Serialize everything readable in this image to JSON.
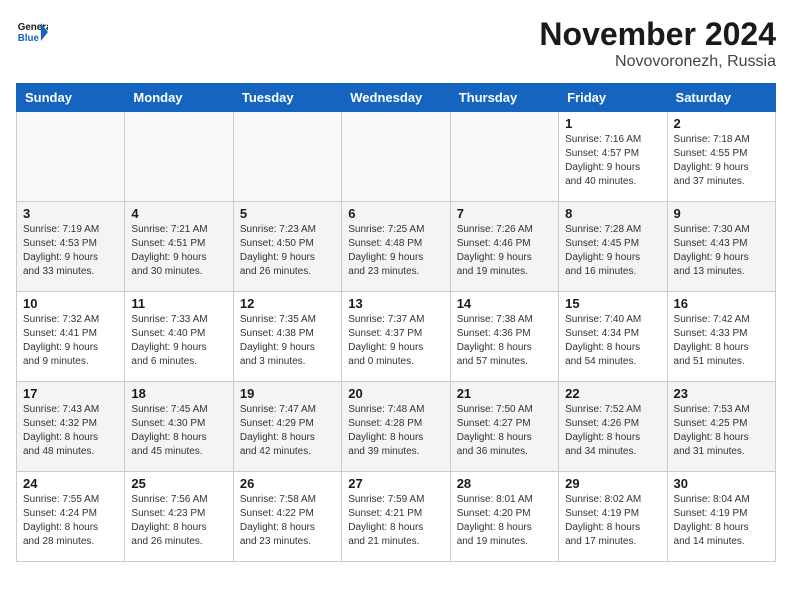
{
  "header": {
    "logo_line1": "General",
    "logo_line2": "Blue",
    "month": "November 2024",
    "location": "Novovoronezh, Russia"
  },
  "weekdays": [
    "Sunday",
    "Monday",
    "Tuesday",
    "Wednesday",
    "Thursday",
    "Friday",
    "Saturday"
  ],
  "weeks": [
    [
      {
        "day": "",
        "info": ""
      },
      {
        "day": "",
        "info": ""
      },
      {
        "day": "",
        "info": ""
      },
      {
        "day": "",
        "info": ""
      },
      {
        "day": "",
        "info": ""
      },
      {
        "day": "1",
        "info": "Sunrise: 7:16 AM\nSunset: 4:57 PM\nDaylight: 9 hours\nand 40 minutes."
      },
      {
        "day": "2",
        "info": "Sunrise: 7:18 AM\nSunset: 4:55 PM\nDaylight: 9 hours\nand 37 minutes."
      }
    ],
    [
      {
        "day": "3",
        "info": "Sunrise: 7:19 AM\nSunset: 4:53 PM\nDaylight: 9 hours\nand 33 minutes."
      },
      {
        "day": "4",
        "info": "Sunrise: 7:21 AM\nSunset: 4:51 PM\nDaylight: 9 hours\nand 30 minutes."
      },
      {
        "day": "5",
        "info": "Sunrise: 7:23 AM\nSunset: 4:50 PM\nDaylight: 9 hours\nand 26 minutes."
      },
      {
        "day": "6",
        "info": "Sunrise: 7:25 AM\nSunset: 4:48 PM\nDaylight: 9 hours\nand 23 minutes."
      },
      {
        "day": "7",
        "info": "Sunrise: 7:26 AM\nSunset: 4:46 PM\nDaylight: 9 hours\nand 19 minutes."
      },
      {
        "day": "8",
        "info": "Sunrise: 7:28 AM\nSunset: 4:45 PM\nDaylight: 9 hours\nand 16 minutes."
      },
      {
        "day": "9",
        "info": "Sunrise: 7:30 AM\nSunset: 4:43 PM\nDaylight: 9 hours\nand 13 minutes."
      }
    ],
    [
      {
        "day": "10",
        "info": "Sunrise: 7:32 AM\nSunset: 4:41 PM\nDaylight: 9 hours\nand 9 minutes."
      },
      {
        "day": "11",
        "info": "Sunrise: 7:33 AM\nSunset: 4:40 PM\nDaylight: 9 hours\nand 6 minutes."
      },
      {
        "day": "12",
        "info": "Sunrise: 7:35 AM\nSunset: 4:38 PM\nDaylight: 9 hours\nand 3 minutes."
      },
      {
        "day": "13",
        "info": "Sunrise: 7:37 AM\nSunset: 4:37 PM\nDaylight: 9 hours\nand 0 minutes."
      },
      {
        "day": "14",
        "info": "Sunrise: 7:38 AM\nSunset: 4:36 PM\nDaylight: 8 hours\nand 57 minutes."
      },
      {
        "day": "15",
        "info": "Sunrise: 7:40 AM\nSunset: 4:34 PM\nDaylight: 8 hours\nand 54 minutes."
      },
      {
        "day": "16",
        "info": "Sunrise: 7:42 AM\nSunset: 4:33 PM\nDaylight: 8 hours\nand 51 minutes."
      }
    ],
    [
      {
        "day": "17",
        "info": "Sunrise: 7:43 AM\nSunset: 4:32 PM\nDaylight: 8 hours\nand 48 minutes."
      },
      {
        "day": "18",
        "info": "Sunrise: 7:45 AM\nSunset: 4:30 PM\nDaylight: 8 hours\nand 45 minutes."
      },
      {
        "day": "19",
        "info": "Sunrise: 7:47 AM\nSunset: 4:29 PM\nDaylight: 8 hours\nand 42 minutes."
      },
      {
        "day": "20",
        "info": "Sunrise: 7:48 AM\nSunset: 4:28 PM\nDaylight: 8 hours\nand 39 minutes."
      },
      {
        "day": "21",
        "info": "Sunrise: 7:50 AM\nSunset: 4:27 PM\nDaylight: 8 hours\nand 36 minutes."
      },
      {
        "day": "22",
        "info": "Sunrise: 7:52 AM\nSunset: 4:26 PM\nDaylight: 8 hours\nand 34 minutes."
      },
      {
        "day": "23",
        "info": "Sunrise: 7:53 AM\nSunset: 4:25 PM\nDaylight: 8 hours\nand 31 minutes."
      }
    ],
    [
      {
        "day": "24",
        "info": "Sunrise: 7:55 AM\nSunset: 4:24 PM\nDaylight: 8 hours\nand 28 minutes."
      },
      {
        "day": "25",
        "info": "Sunrise: 7:56 AM\nSunset: 4:23 PM\nDaylight: 8 hours\nand 26 minutes."
      },
      {
        "day": "26",
        "info": "Sunrise: 7:58 AM\nSunset: 4:22 PM\nDaylight: 8 hours\nand 23 minutes."
      },
      {
        "day": "27",
        "info": "Sunrise: 7:59 AM\nSunset: 4:21 PM\nDaylight: 8 hours\nand 21 minutes."
      },
      {
        "day": "28",
        "info": "Sunrise: 8:01 AM\nSunset: 4:20 PM\nDaylight: 8 hours\nand 19 minutes."
      },
      {
        "day": "29",
        "info": "Sunrise: 8:02 AM\nSunset: 4:19 PM\nDaylight: 8 hours\nand 17 minutes."
      },
      {
        "day": "30",
        "info": "Sunrise: 8:04 AM\nSunset: 4:19 PM\nDaylight: 8 hours\nand 14 minutes."
      }
    ]
  ]
}
